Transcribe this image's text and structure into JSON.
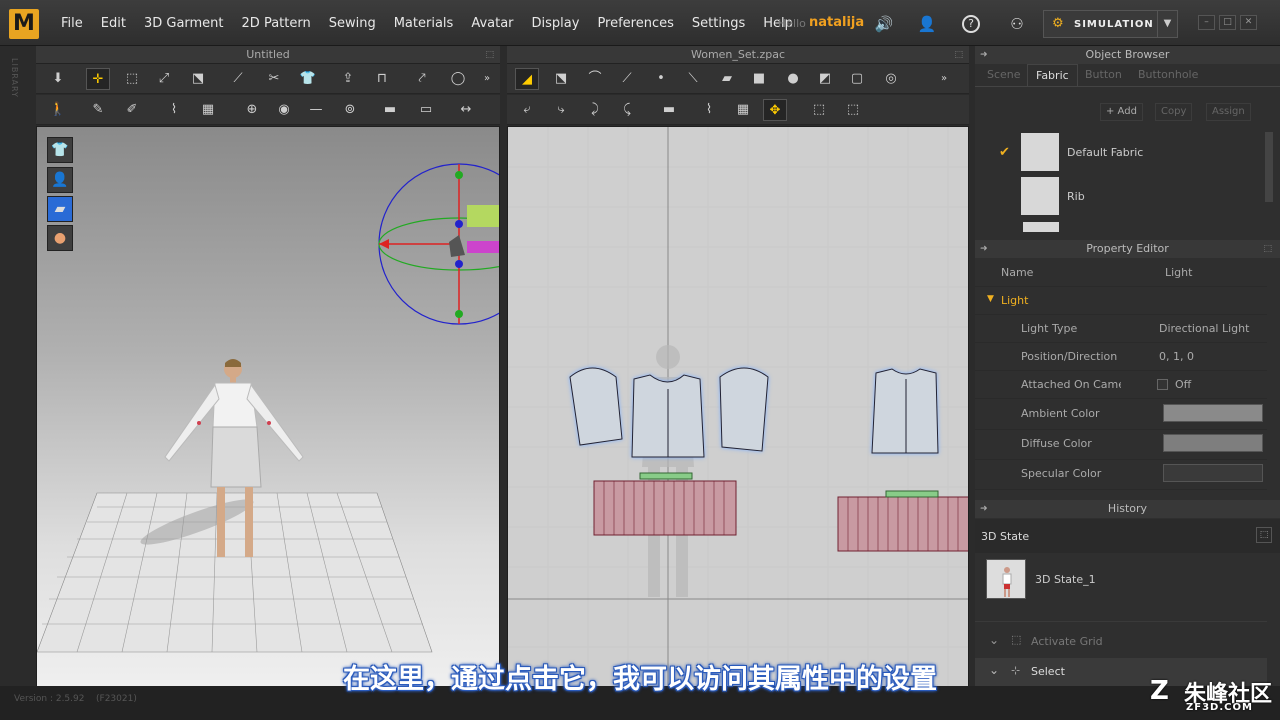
{
  "app": {
    "logo": "M",
    "hello": "Hello",
    "user": "natalija",
    "simulation": "SIMULATION",
    "version": "Version : 2.5.92",
    "build": "(F23021)"
  },
  "menu": [
    "File",
    "Edit",
    "3D Garment",
    "2D Pattern",
    "Sewing",
    "Materials",
    "Avatar",
    "Display",
    "Preferences",
    "Settings",
    "Help"
  ],
  "left_strip": {
    "label": "LIBRARY"
  },
  "panel3d": {
    "title": "Untitled"
  },
  "panel2d": {
    "title": "Women_Set.zpac"
  },
  "object_browser": {
    "title": "Object Browser",
    "tabs": [
      "Scene",
      "Fabric",
      "Button",
      "Buttonhole"
    ],
    "selected_tab": "Fabric",
    "buttons": {
      "add": "+ Add",
      "copy": "Copy",
      "assign": "Assign"
    },
    "fabrics": [
      {
        "name": "Default Fabric",
        "checked": true
      },
      {
        "name": "Rib",
        "checked": false
      }
    ]
  },
  "property_editor": {
    "title": "Property Editor",
    "name_label": "Name",
    "name_value": "Light",
    "section": "Light",
    "rows": [
      {
        "key": "Light Type",
        "value": "Directional Light"
      },
      {
        "key": "Position/Direction",
        "value": "0, 1, 0"
      },
      {
        "key": "Attached On Camera",
        "value": "Off"
      },
      {
        "key": "Ambient Color",
        "value": "",
        "color": "#8a8a8a"
      },
      {
        "key": "Diffuse Color",
        "value": "",
        "color": "#7e7e7e"
      },
      {
        "key": "Specular Color",
        "value": "",
        "color": "#3a3a3a"
      }
    ]
  },
  "history": {
    "title": "History",
    "state_header": "3D State",
    "item": "3D State_1",
    "activate_grid": "Activate Grid",
    "select": "Select"
  },
  "subtitle": "在这里，通过点击它，我可以访问其属性中的设置",
  "watermark": {
    "main": "朱峰社区",
    "sub": "ZF3D.COM"
  },
  "icons": {
    "volume": "speaker-icon",
    "account": "user-icon",
    "help": "help-icon",
    "avatar": "avatar-icon"
  }
}
